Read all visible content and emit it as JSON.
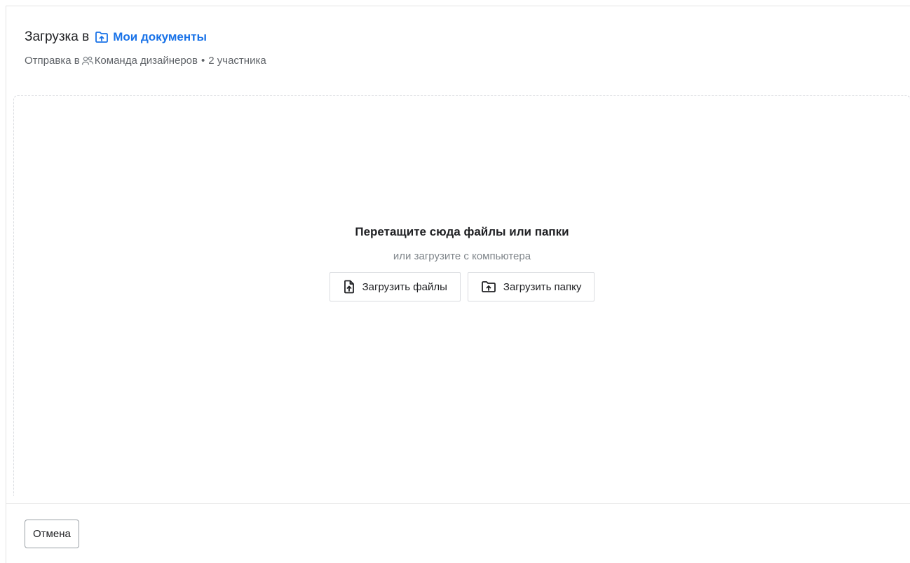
{
  "header": {
    "title_prefix": "Загрузка в",
    "folder_name": "Мои документы",
    "folder_icon": "folder-upload-icon",
    "subtitle_prefix": "Отправка в",
    "team_icon": "team-icon",
    "team_name": "Команда дизайнеров",
    "separator": "•",
    "members": "2 участника"
  },
  "dropzone": {
    "title": "Перетащите сюда файлы или папки",
    "subtitle": "или загрузите с компьютера",
    "upload_files_label": "Загрузить файлы",
    "upload_files_icon": "file-upload-icon",
    "upload_folder_label": "Загрузить папку",
    "upload_folder_icon": "folder-upload-icon"
  },
  "footer": {
    "cancel_label": "Отмена"
  },
  "colors": {
    "accent": "#1a73e8",
    "text": "#202124",
    "muted": "#5f6368",
    "border": "#dadce0"
  }
}
